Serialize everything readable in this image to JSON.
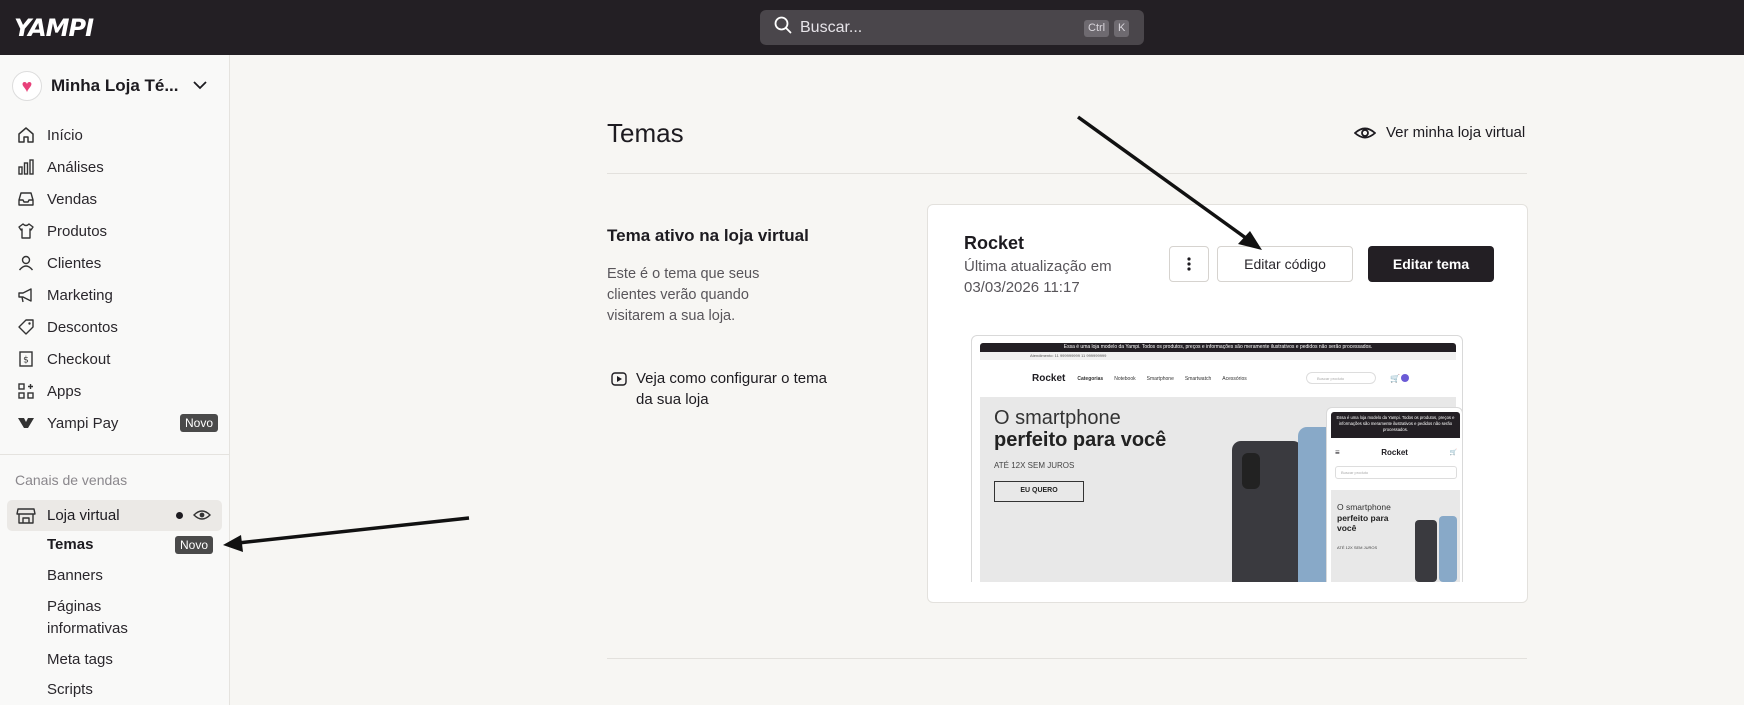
{
  "topbar": {
    "logo": "YAMPI",
    "search_placeholder": "Buscar...",
    "shortcut_ctrl": "Ctrl",
    "shortcut_key": "K"
  },
  "sidebar": {
    "store_name": "Minha Loja Té...",
    "items": [
      {
        "label": "Início",
        "icon": "home-icon"
      },
      {
        "label": "Análises",
        "icon": "bar-chart-icon"
      },
      {
        "label": "Vendas",
        "icon": "inbox-icon"
      },
      {
        "label": "Produtos",
        "icon": "shirt-icon"
      },
      {
        "label": "Clientes",
        "icon": "user-icon"
      },
      {
        "label": "Marketing",
        "icon": "megaphone-icon"
      },
      {
        "label": "Descontos",
        "icon": "tag-icon"
      },
      {
        "label": "Checkout",
        "icon": "receipt-icon"
      },
      {
        "label": "Apps",
        "icon": "apps-icon"
      },
      {
        "label": "Yampi Pay",
        "icon": "yampi-pay-icon",
        "badge": "Novo"
      }
    ],
    "section_label": "Canais de vendas",
    "active_channel": "Loja virtual",
    "sub_items": [
      {
        "label": "Temas",
        "badge": "Novo"
      },
      {
        "label": "Banners"
      },
      {
        "label": "Páginas informativas"
      },
      {
        "label": "Meta tags"
      },
      {
        "label": "Scripts"
      }
    ]
  },
  "main": {
    "title": "Temas",
    "view_store": "Ver minha loja virtual",
    "section_title": "Tema ativo na loja virtual",
    "section_desc": "Este é o tema que seus clientes verão quando visitarem a sua loja.",
    "help_link": "Veja como configurar o tema da sua loja",
    "card": {
      "theme_name": "Rocket",
      "updated": "Última atualização em 03/03/2026 11:17",
      "edit_code": "Editar código",
      "edit_theme": "Editar tema"
    },
    "preview": {
      "announcement": "Essa é uma loja modelo da Yampi. Todos os produtos, preços e informações são meramente ilustrativos e pedidos não serão processados.",
      "support_bar": "Atendimento:  11 999999999   11 999999999",
      "logo": "Rocket",
      "nav": [
        "Categorias",
        "Notebook",
        "Smartphone",
        "Smartwatch",
        "Acessórios"
      ],
      "search": "Buscar produto",
      "hero_line1": "O smartphone",
      "hero_line2": "perfeito para você",
      "hero_line3": "ATÉ 12X SEM JUROS",
      "hero_button": "EU QUERO",
      "mobile_line1": "O smartphone",
      "mobile_line2": "perfeito para você",
      "mobile_line3": "ATÉ 12X SEM JUROS"
    }
  },
  "colors": {
    "topbar": "#231f24",
    "primary_button": "#231f24",
    "badge": "#4a4a4a",
    "background": "#f7f6f3"
  }
}
